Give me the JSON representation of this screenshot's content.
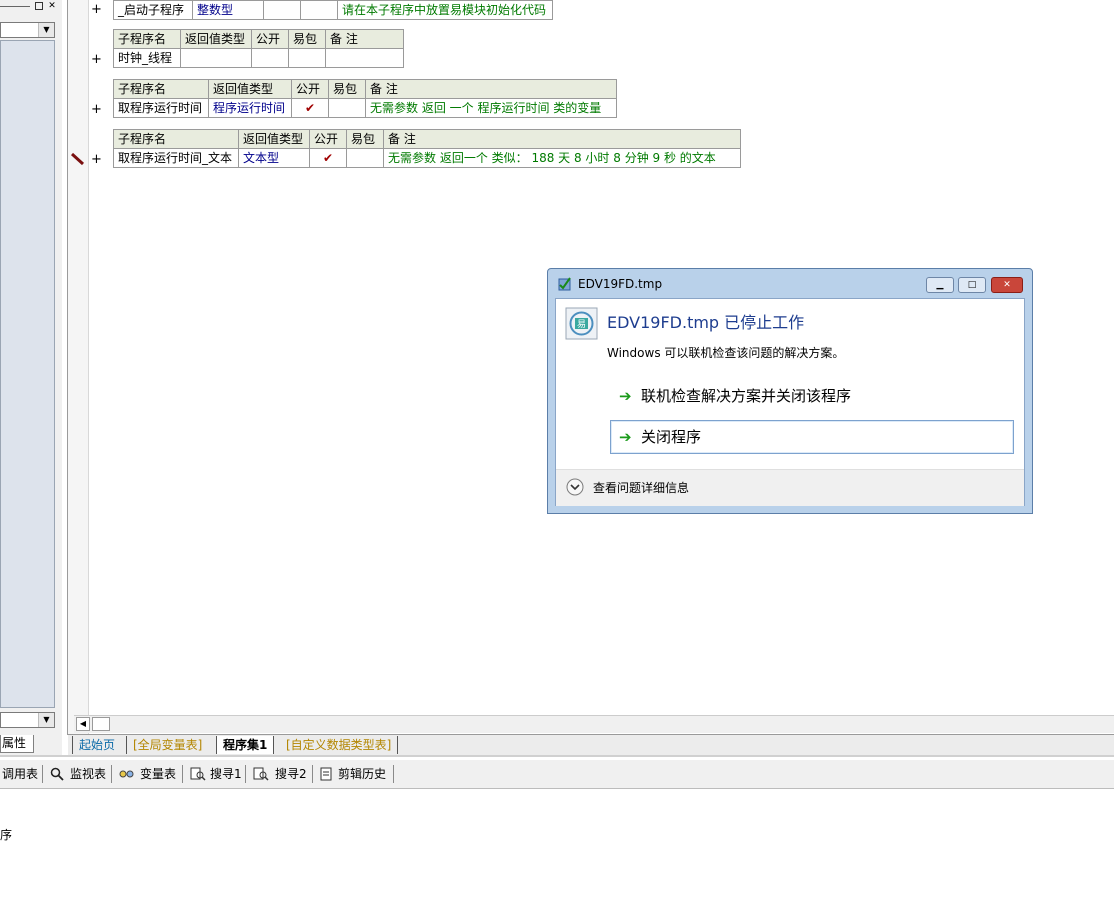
{
  "left_panel": {
    "properties_tab": "属性"
  },
  "procedures": [
    {
      "partial": true,
      "name": "_启动子程序",
      "return_type": "整数型",
      "public": "",
      "easy_pack": "",
      "note": "请在本子程序中放置易模块初始化代码"
    },
    {
      "headers": [
        "子程序名",
        "返回值类型",
        "公开",
        "易包",
        "备 注"
      ],
      "name": "时钟_线程",
      "return_type": "",
      "public": "",
      "easy_pack": "",
      "note": ""
    },
    {
      "headers": [
        "子程序名",
        "返回值类型",
        "公开",
        "易包",
        "备 注"
      ],
      "name": "取程序运行时间",
      "return_type": "程序运行时间",
      "public": "✔",
      "easy_pack": "",
      "note": "无需参数 返回 一个 程序运行时间 类的变量"
    },
    {
      "headers": [
        "子程序名",
        "返回值类型",
        "公开",
        "易包",
        "备 注"
      ],
      "name": "取程序运行时间_文本",
      "return_type": "文本型",
      "public": "✔",
      "easy_pack": "",
      "note": "无需参数 返回一个 类似： 188 天 8 小时 8 分钟 9 秒  的文本"
    }
  ],
  "plus_sign": "+",
  "tabs": {
    "start_page": "起始页",
    "global_vars": "[全局变量表]",
    "program_set": "程序集1",
    "custom_types": "[自定义数据类型表]"
  },
  "toolbar": {
    "call_table": "调用表",
    "watch_table": "监视表",
    "var_table": "变量表",
    "search1": "搜寻1",
    "search2": "搜寻2",
    "clip_history": "剪辑历史"
  },
  "output": {
    "text": "序"
  },
  "dialog": {
    "title": "EDV19FD.tmp",
    "heading": "EDV19FD.tmp 已停止工作",
    "message": "Windows 可以联机检查该问题的解决方案。",
    "option_check_online": "联机检查解决方案并关闭该程序",
    "option_close": "关闭程序",
    "details": "查看问题详细信息",
    "accent": "#1e3d8f"
  }
}
